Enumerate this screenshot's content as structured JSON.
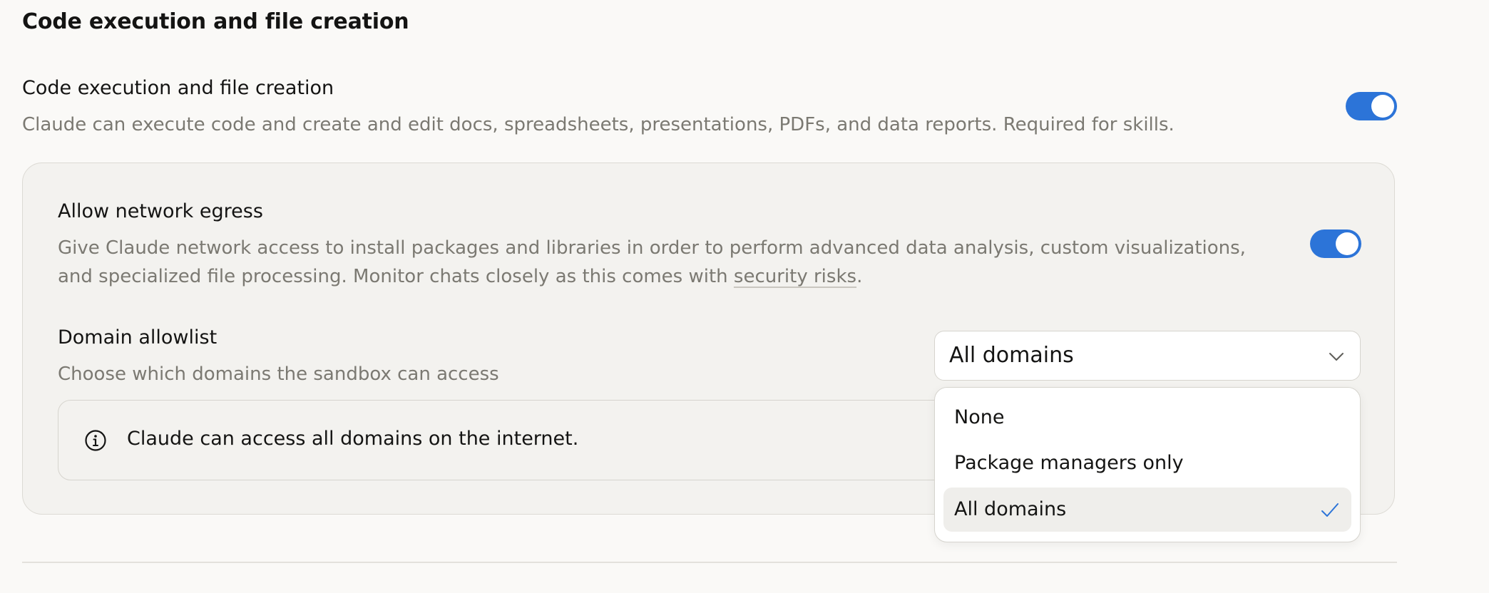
{
  "section": {
    "title": "Code execution and file creation"
  },
  "code_execution": {
    "title": "Code execution and file creation",
    "description": "Claude can execute code and create and edit docs, spreadsheets, presentations, PDFs, and data reports. Required for skills.",
    "enabled": true
  },
  "network_egress": {
    "title": "Allow network egress",
    "description_line1": "Give Claude network access to install packages and libraries in order to perform advanced data analysis, custom visualizations,",
    "description_line2_prefix": "and specialized file processing. Monitor chats closely as this comes with ",
    "link_text": "security risks",
    "description_line2_suffix": ".",
    "enabled": true
  },
  "domain_allowlist": {
    "title": "Domain allowlist",
    "description": "Choose which domains the sandbox can access",
    "selected_value": "All domains",
    "options": [
      {
        "label": "None",
        "selected": false
      },
      {
        "label": "Package managers only",
        "selected": false
      },
      {
        "label": "All domains",
        "selected": true
      }
    ]
  },
  "info": {
    "icon": "info-icon",
    "text": "Claude can access all domains on the internet."
  },
  "colors": {
    "accent": "#2c74d8",
    "background": "#faf9f7",
    "panel": "#f3f2ef",
    "muted_text": "#7b7972"
  }
}
